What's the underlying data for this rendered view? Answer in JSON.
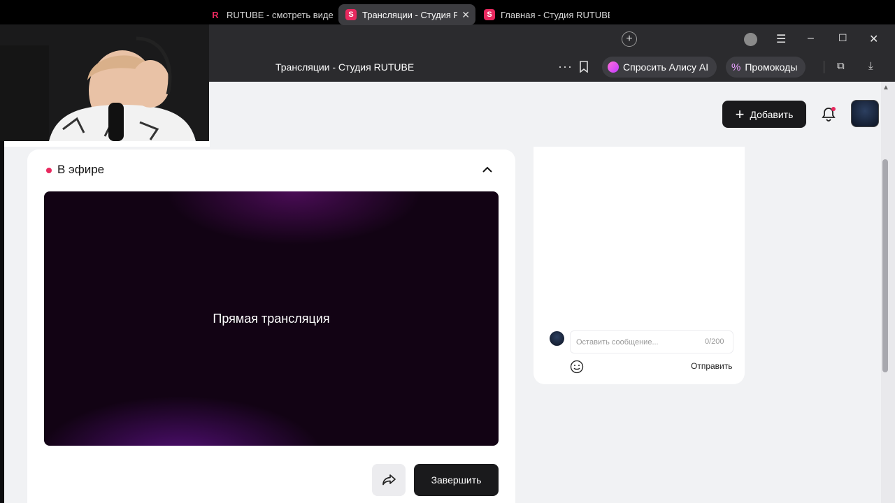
{
  "browser": {
    "tabs": [
      {
        "label": "RUTUBE - смотреть видео",
        "favicon": "R",
        "active": false
      },
      {
        "label": "Трансляции - Студия RUTUBE",
        "favicon": "S",
        "active": true
      },
      {
        "label": "Главная - Студия RUTUBE",
        "favicon": "S",
        "active": false
      }
    ],
    "page_title": "Трансляции - Студия RUTUBE",
    "alisa_label": "Спросить Алису AI",
    "promo_label": "Промокоды",
    "menu_dots": "···"
  },
  "header": {
    "add_label": "Добавить"
  },
  "live": {
    "status_label": "В эфире",
    "player_title": "Прямая трансляция",
    "end_label": "Завершить"
  },
  "chat": {
    "placeholder": "Оставить сообщение...",
    "counter": "0/200",
    "send_label": "Отправить"
  },
  "colors": {
    "accent": "#e8295f",
    "dark_button": "#1a1a1c",
    "page_bg": "#f1f2f4",
    "chrome_bg": "#2b2b2e"
  },
  "icons": [
    "rutube-favicon",
    "studio-favicon",
    "tab-close-icon",
    "new-tab-icon",
    "profile-icon",
    "menu-icon",
    "minimize-icon",
    "maximize-icon",
    "close-window-icon",
    "more-icon",
    "bookmark-icon",
    "alisa-icon",
    "promo-percent-icon",
    "split-view-icon",
    "download-icon",
    "plus-icon",
    "bell-icon",
    "chevron-up-icon",
    "share-icon",
    "emoji-icon"
  ]
}
